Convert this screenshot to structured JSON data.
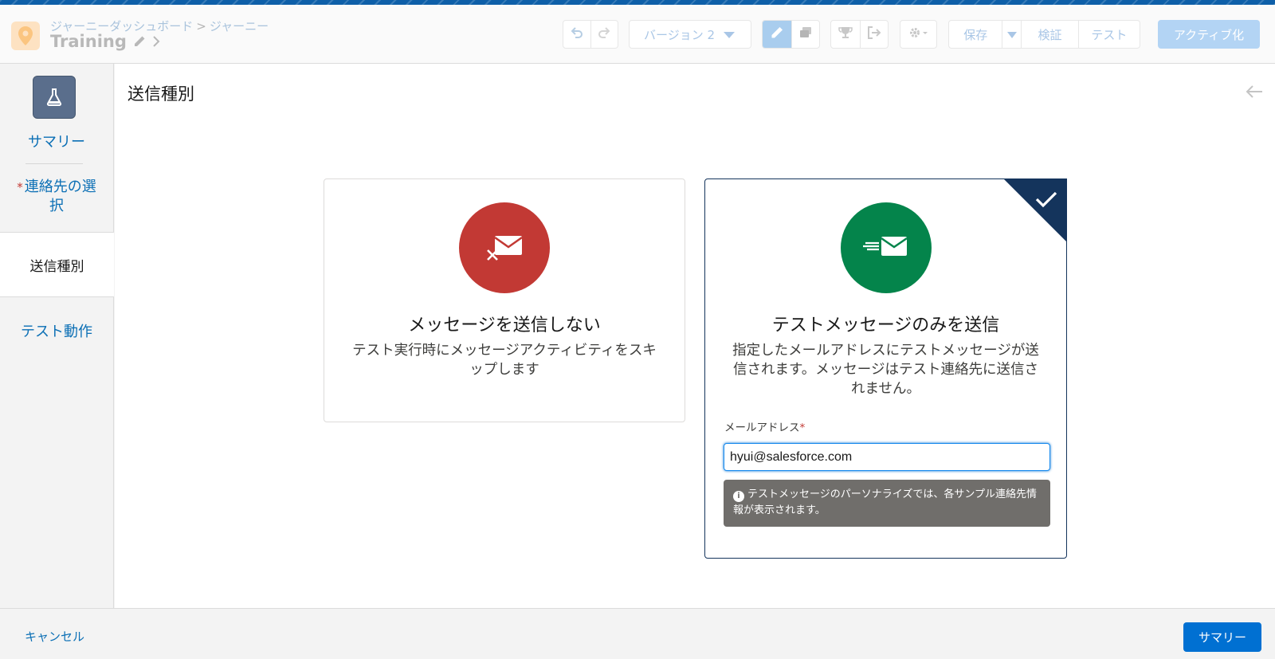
{
  "header": {
    "breadcrumb_parent": "ジャーニーダッシュボード",
    "breadcrumb_separator": ">",
    "breadcrumb_current": "ジャーニー",
    "journey_name": "Training",
    "version_label": "バージョン 2",
    "save_label": "保存",
    "validate_label": "検証",
    "test_label": "テスト",
    "activate_label": "アクティブ化"
  },
  "sidebar": {
    "summary_label": "サマリー",
    "contact_label": "連絡先の選択",
    "contact_required_mark": "*",
    "send_type_label": "送信種別",
    "test_action_label": "テスト動作"
  },
  "main": {
    "title": "送信種別",
    "option_skip": {
      "title": "メッセージを送信しない",
      "description": "テスト実行時にメッセージアクティビティをスキップします"
    },
    "option_test": {
      "title": "テストメッセージのみを送信",
      "description": "指定したメールアドレスにテストメッセージが送信されます。メッセージはテスト連絡先に送信されません。",
      "email_label": "メールアドレス",
      "email_required_mark": "*",
      "email_value": "hyui@salesforce.com",
      "info_text": "テストメッセージのパーソナライズでは、各サンプル連絡先情報が表示されます。"
    }
  },
  "footer": {
    "cancel_label": "キャンセル",
    "summary_button_label": "サマリー"
  },
  "icons": {
    "app": "location-pin-icon",
    "undo": "undo-icon",
    "redo": "redo-icon",
    "edit": "pencil-icon",
    "stack": "stack-icon",
    "trophy": "trophy-icon",
    "exit": "exit-icon",
    "settings": "gear-icon",
    "flask": "flask-icon",
    "back": "arrow-left-icon",
    "no_send": "email-cancel-icon",
    "send": "email-send-icon",
    "check": "check-icon",
    "info": "info-icon"
  },
  "colors": {
    "accent": "#0070d2",
    "skip_circle": "#c23934",
    "send_circle": "#04844b",
    "selected_border": "#14345c"
  }
}
